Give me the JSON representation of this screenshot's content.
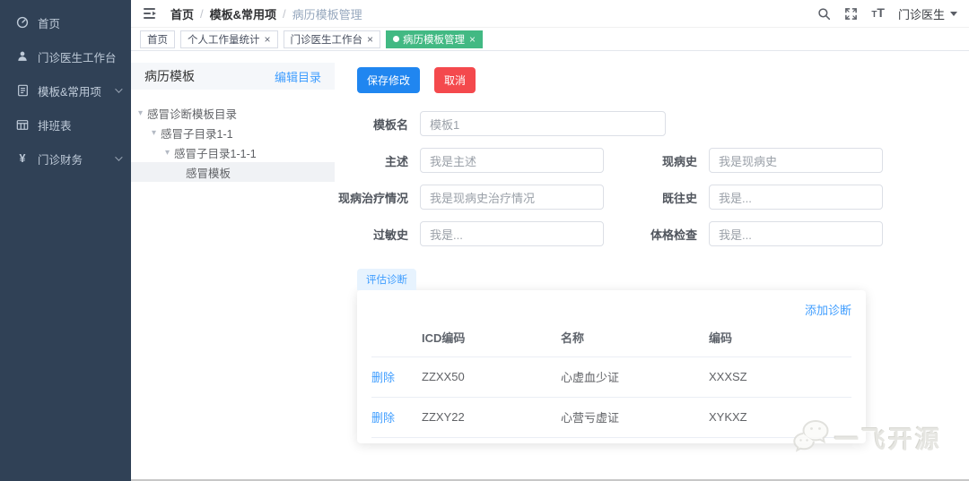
{
  "colors": {
    "sidebar_bg": "#304156",
    "primary_blue": "#2086f0",
    "danger_red": "#f4494d",
    "active_tag_green": "#42b983",
    "link_blue": "#409eff"
  },
  "icons": {
    "tree_caret": "▾",
    "close": "×",
    "yuan_glyph": "¥",
    "font_small": "T",
    "font_large": "T"
  },
  "sidebar": {
    "items": [
      {
        "label": "首页"
      },
      {
        "label": "门诊医生工作台"
      },
      {
        "label": "模板&常用项",
        "expandable": true
      },
      {
        "label": "排班表"
      },
      {
        "label": "门诊财务",
        "expandable": true
      }
    ]
  },
  "navbar": {
    "breadcrumb": {
      "separator": "/",
      "items": [
        "首页",
        "模板&常用项",
        "病历模板管理"
      ]
    },
    "user": {
      "name": "门诊医生"
    }
  },
  "tags": {
    "items": [
      {
        "label": "首页",
        "closable": false,
        "active": false
      },
      {
        "label": "个人工作量统计",
        "closable": true,
        "active": false
      },
      {
        "label": "门诊医生工作台",
        "closable": true,
        "active": false
      },
      {
        "label": "病历模板管理",
        "closable": true,
        "active": true
      }
    ]
  },
  "panel": {
    "title": "病历模板",
    "edit_link": "编辑目录",
    "tree": [
      {
        "label": "感冒诊断模板目录",
        "level": 0,
        "expanded": true
      },
      {
        "label": "感冒子目录1-1",
        "level": 1,
        "expanded": true
      },
      {
        "label": "感冒子目录1-1-1",
        "level": 2,
        "expanded": true
      },
      {
        "label": "感冒模板",
        "level": 3,
        "selected": true
      }
    ]
  },
  "form": {
    "save_label": "保存修改",
    "cancel_label": "取消",
    "fields": {
      "template_name": {
        "label": "模板名",
        "value": "模板1"
      },
      "chief_complaint": {
        "label": "主述",
        "value": "我是主述"
      },
      "present_illness": {
        "label": "现病史",
        "value": "我是现病史"
      },
      "treatment_status": {
        "label": "现病治疗情况",
        "value": "我是现病史治疗情况"
      },
      "past_history": {
        "label": "既往史",
        "value": "我是..."
      },
      "allergy_history": {
        "label": "过敏史",
        "value": "我是..."
      },
      "physical_exam": {
        "label": "体格检查",
        "value": "我是..."
      }
    },
    "diagnosis_tab_label": "评估诊断"
  },
  "diagnosis": {
    "add_link": "添加诊断",
    "delete_label": "删除",
    "columns": [
      "ICD编码",
      "名称",
      "编码"
    ],
    "rows": [
      {
        "icd": "ZZXX50",
        "name": "心虚血少证",
        "code": "XXXSZ"
      },
      {
        "icd": "ZZXY22",
        "name": "心营亏虚证",
        "code": "XYKXZ"
      }
    ]
  },
  "watermark": {
    "text": "一飞开源"
  }
}
